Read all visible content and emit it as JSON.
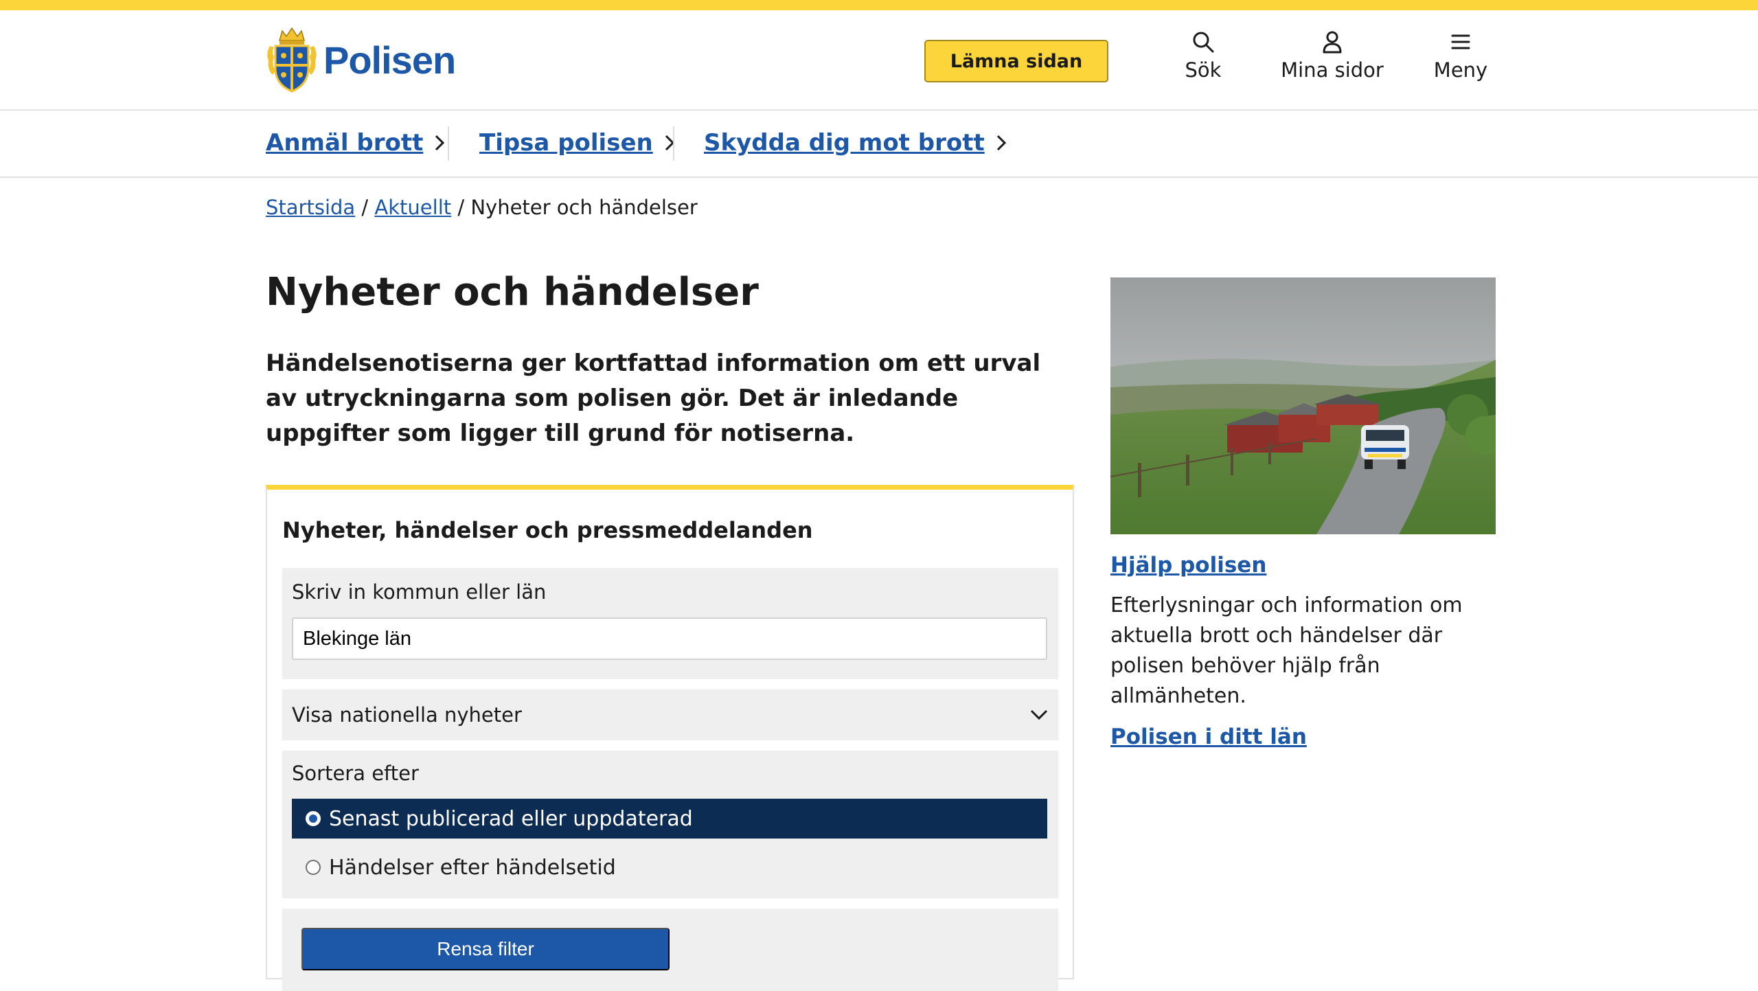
{
  "header": {
    "logo_text": "Polisen",
    "leave_button": "Lämna sidan",
    "search_label": "Sök",
    "mypages_label": "Mina sidor",
    "menu_label": "Meny"
  },
  "quicknav": [
    {
      "label": "Anmäl brott"
    },
    {
      "label": "Tipsa polisen"
    },
    {
      "label": "Skydda dig mot brott"
    }
  ],
  "breadcrumb": {
    "home": "Startsida",
    "sep1": " / ",
    "news": "Aktuellt",
    "sep2": " / ",
    "current": "Nyheter och händelser"
  },
  "page": {
    "title": "Nyheter och händelser",
    "lead": "Händelsenotiserna ger kortfattad information om ett urval av utryckningarna som polisen gör. Det är inledande uppgifter som ligger till grund för notiserna."
  },
  "filter": {
    "title": "Nyheter, händelser och pressmeddelanden",
    "location_label": "Skriv in kommun eller län",
    "location_value": "Blekinge län",
    "national_select": "Visa nationella nyheter",
    "sort_label": "Sortera efter",
    "sort_options": [
      {
        "label": "Senast publicerad eller uppdaterad",
        "selected": true
      },
      {
        "label": "Händelser efter händelsetid",
        "selected": false
      }
    ],
    "clear_button": "Rensa filter"
  },
  "sidebar": {
    "help_link": "Hjälp polisen",
    "help_text": "Efterlysningar och information om aktuella brott och händelser där polisen behöver hjälp från allmänheten.",
    "county_link": "Polisen i ditt län"
  },
  "colors": {
    "accent_yellow": "#fcd53a",
    "link_blue": "#1d57a8",
    "navy": "#0d2c53"
  }
}
